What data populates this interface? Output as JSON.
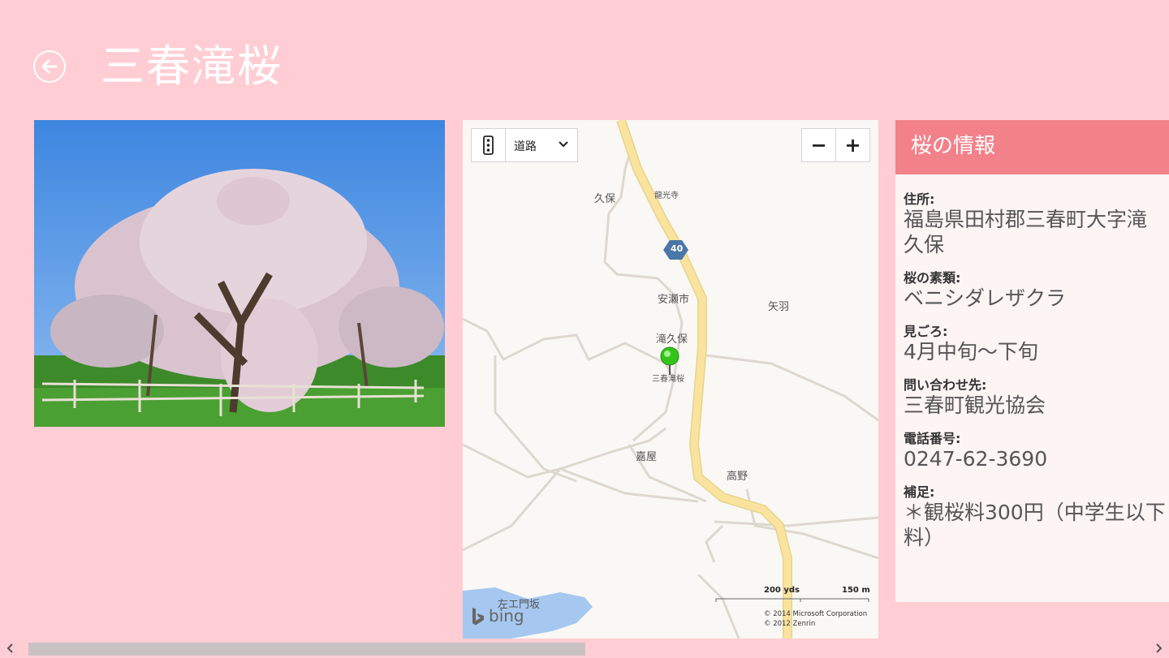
{
  "header": {
    "title": "三春滝桜",
    "back_icon": "back-arrow-icon"
  },
  "photo": {
    "alt": "三春滝桜"
  },
  "map": {
    "style_label": "道路",
    "zoom_out": "−",
    "zoom_in": "+",
    "route_number": "40",
    "labels": {
      "kubo": "久保",
      "ryukoji": "龍光寺",
      "yasegaichi": "安瀬市",
      "yaba": "矢羽",
      "takikubo": "滝久保",
      "pin": "三春滝桜",
      "kaya": "嘉屋",
      "takano": "高野",
      "saemonzaka": "左エ門坂"
    },
    "scale_yds": "200 yds",
    "scale_m": "150 m",
    "copyright_1": "© 2014 Microsoft Corporation",
    "copyright_2": "© 2012 Zenrin",
    "bing": "bing",
    "colors": {
      "road_major": "#f9e39f",
      "water": "#a6c8f0",
      "pin": "#33c41a"
    }
  },
  "info": {
    "title": "桜の情報",
    "fields": [
      {
        "label": "住所:",
        "value_1": "福島県田村郡三春町大字滝",
        "value_2": "久保"
      },
      {
        "label": "桜の素類:",
        "value_1": "ベニシダレザクラ"
      },
      {
        "label": "見ごろ:",
        "value_1": "4月中旬～下旬"
      },
      {
        "label": "問い合わせ先:",
        "value_1": "三春町観光協会"
      },
      {
        "label": "電話番号:",
        "value_1": "0247-62-3690"
      },
      {
        "label": "補足:",
        "value_1": "＊観桜料300円（中学生以下",
        "value_2": "料）"
      }
    ]
  },
  "colors": {
    "background": "#ffcdd3",
    "header_bar": "#f28189",
    "panel": "#fdf4f4"
  }
}
